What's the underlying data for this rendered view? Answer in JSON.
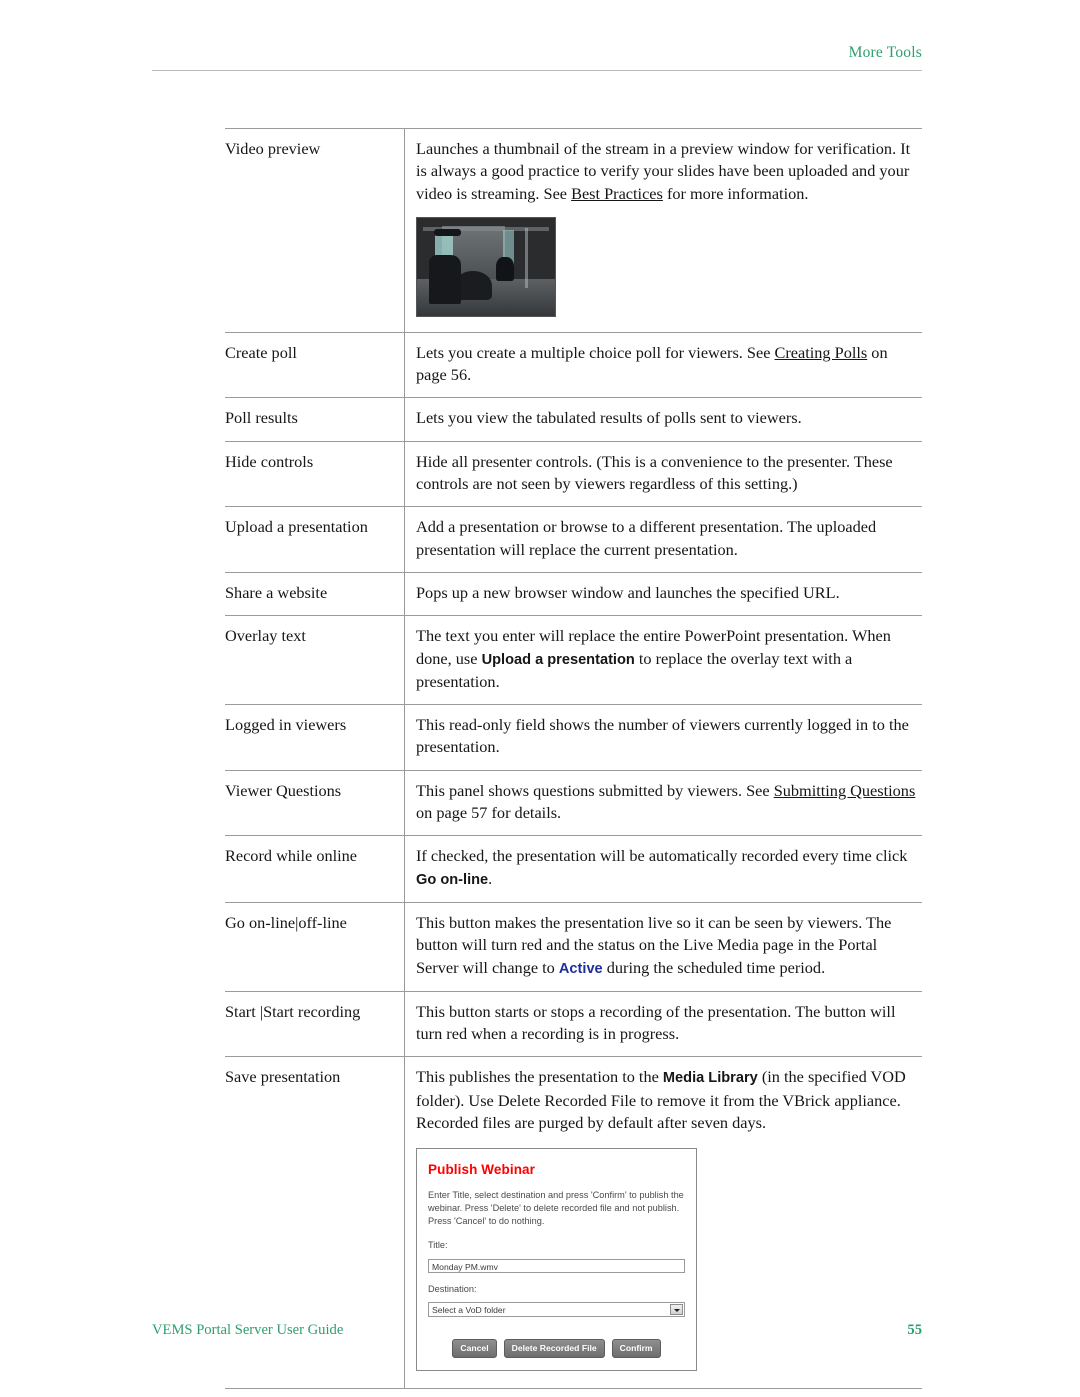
{
  "header": {
    "title": "More Tools"
  },
  "table": {
    "rows": [
      {
        "term": "Video preview",
        "desc_parts": [
          {
            "t": "Launches a thumbnail of the stream in a preview window for verification. It is always a good practice to verify your slides have been uploaded and your video is streaming. See ",
            "s": "plain"
          },
          {
            "t": "Best Practices",
            "s": "link"
          },
          {
            "t": " for more information.",
            "s": "plain"
          }
        ],
        "media": "video-thumbnail"
      },
      {
        "term": "Create poll",
        "desc_parts": [
          {
            "t": "Lets you create a multiple choice poll for viewers. See ",
            "s": "plain"
          },
          {
            "t": "Creating Polls",
            "s": "link"
          },
          {
            "t": " on page 56.",
            "s": "plain"
          }
        ]
      },
      {
        "term": "Poll results",
        "desc_parts": [
          {
            "t": "Lets you view the tabulated results of polls sent to viewers.",
            "s": "plain"
          }
        ]
      },
      {
        "term": "Hide controls",
        "desc_parts": [
          {
            "t": "Hide all presenter controls. (This is a convenience to the presenter. These controls are not seen by viewers regardless of this setting.)",
            "s": "plain"
          }
        ]
      },
      {
        "term": "Upload a presentation",
        "desc_parts": [
          {
            "t": "Add a presentation or browse to a different presentation. The uploaded presentation will replace the current presentation.",
            "s": "plain"
          }
        ]
      },
      {
        "term": "Share a website",
        "desc_parts": [
          {
            "t": "Pops up a new browser window and launches the specified URL.",
            "s": "plain"
          }
        ]
      },
      {
        "term": "Overlay text",
        "desc_parts": [
          {
            "t": "The text you enter will replace the entire PowerPoint presentation. When done, use ",
            "s": "plain"
          },
          {
            "t": "Upload a presentation",
            "s": "ui-bold"
          },
          {
            "t": " to replace the overlay text with a presentation.",
            "s": "plain"
          }
        ]
      },
      {
        "term": "Logged in viewers",
        "desc_parts": [
          {
            "t": "This read-only field shows the number of viewers currently logged in to the presentation.",
            "s": "plain"
          }
        ]
      },
      {
        "term": "Viewer Questions",
        "desc_parts": [
          {
            "t": "This panel shows questions submitted by viewers. See ",
            "s": "plain"
          },
          {
            "t": "Submitting Questions",
            "s": "link"
          },
          {
            "t": " on page 57 for details.",
            "s": "plain"
          }
        ]
      },
      {
        "term": "Record while online",
        "desc_parts": [
          {
            "t": "If checked, the presentation will be automatically recorded every time click ",
            "s": "plain"
          },
          {
            "t": "Go on-line",
            "s": "ui-bold"
          },
          {
            "t": ".",
            "s": "plain"
          }
        ]
      },
      {
        "term": "Go on-line|off-line",
        "desc_parts": [
          {
            "t": "This button makes the presentation live so it can be seen by viewers. The button will turn red and the status on the Live Media page in the Portal Server will change to ",
            "s": "plain"
          },
          {
            "t": "Active",
            "s": "status-active"
          },
          {
            "t": " during the scheduled time period.",
            "s": "plain"
          }
        ]
      },
      {
        "term": "Start |Start recording",
        "desc_parts": [
          {
            "t": "This button starts or stops a recording of the presentation. The button will turn red when a recording is in progress.",
            "s": "plain"
          }
        ]
      },
      {
        "term": "Save presentation",
        "desc_parts": [
          {
            "t": "This publishes the presentation to the ",
            "s": "plain"
          },
          {
            "t": "Media Library",
            "s": "ui-bold"
          },
          {
            "t": " (in the specified VOD folder). Use Delete Recorded File to remove it from the VBrick appliance. Recorded files are purged by default after seven days.",
            "s": "plain"
          }
        ],
        "media": "publish-webinar-dialog"
      }
    ]
  },
  "dialog": {
    "title": "Publish Webinar",
    "description": "Enter Title, select destination and press 'Confirm' to publish the webinar. Press 'Delete' to delete recorded file and not publish. Press 'Cancel' to do nothing.",
    "title_label": "Title:",
    "title_value": "Monday PM.wmv",
    "destination_label": "Destination:",
    "destination_value": "Select a VoD folder",
    "buttons": [
      "Cancel",
      "Delete Recorded File",
      "Confirm"
    ]
  },
  "footer": {
    "guide": "VEMS Portal Server User Guide",
    "page": "55"
  },
  "colors": {
    "accent_green": "#2d9e6d",
    "dialog_title_red": "#ff0000",
    "status_blue": "#1f2f9e",
    "rule_gray": "#9b9b9b"
  }
}
